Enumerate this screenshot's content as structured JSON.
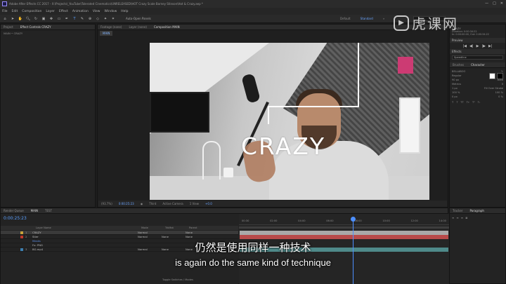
{
  "window": {
    "title": "Adobe After Effects CC 2017 - X:\\Projects\\_YouTube\\Tolerated Cinematics\\UNRELEASED\\HOT Crazy Scale Barney Stinson\\Hot & Crazy.aep *",
    "min": "—",
    "max": "□",
    "close": "✕"
  },
  "menu": [
    "File",
    "Edit",
    "Composition",
    "Layer",
    "Effect",
    "Animation",
    "View",
    "Window",
    "Help"
  ],
  "toolbar": {
    "auto_open": "Auto-Open Panels",
    "workspaces": [
      "Default",
      "Standard",
      "»"
    ],
    "active_workspace": "Standard"
  },
  "left_panel": {
    "tabs": [
      "Project",
      "Effect Controls CRAZY"
    ],
    "breadcrumb": "MAIN • CRAZY"
  },
  "comp_panel": {
    "tabs": [
      "Footage (none)",
      "Layer (none)",
      "Composition MAIN"
    ],
    "sub_tab": "MAIN",
    "overlay_text": "CRAZY",
    "bar": {
      "zoom": "(93.7%)",
      "timecode": "0:00:25:23",
      "resolution": "Third",
      "camera": "Active Camera",
      "view": "1 View",
      "exposure": "+0.0"
    }
  },
  "right_panel": {
    "info_title": "CRAZY",
    "info_lines": [
      "Duration: 0:00:34:22",
      "In: 0:00:00:00, Out: 0:00:34:22"
    ],
    "preview": "Preview",
    "preview_controls": [
      "|◀",
      "◀|",
      "▶",
      "|▶",
      "▶|"
    ],
    "effects": "Effects",
    "effects_field": "Speedline",
    "brushes": "Brushes",
    "character": "Character",
    "font": "BELLABOO",
    "font_style": "Regular",
    "size": "90 px",
    "leading": "Auto",
    "metrics": "Metrics",
    "tracking": "0",
    "stroke": "1 px",
    "stroke_mode": "Fill Over Stroke",
    "scale_v": "100 %",
    "scale_h": "100 %",
    "baseline": "0 px",
    "tsume": "0 %"
  },
  "timeline": {
    "tabs": [
      "Render Queue",
      "MAIN",
      "TEST"
    ],
    "time": "0:00:25:23",
    "columns": [
      "Layer Name",
      "Mode",
      "TrkMat",
      "Parent"
    ],
    "layers": [
      {
        "num": "1",
        "name": "CRAZY",
        "mode": "Normal",
        "trkmat": "",
        "parent": "None",
        "color": "#c9a23a"
      },
      {
        "num": "2",
        "name": "Stier",
        "mode": "Normal",
        "trkmat": "None",
        "parent": "None",
        "color": "#c0392b"
      },
      {
        "num": "",
        "name": "Masks",
        "mode": "",
        "trkmat": "",
        "parent": "",
        "color": "#2c62c4"
      },
      {
        "num": "",
        "name": "Fx: PNG",
        "mode": "",
        "trkmat": "",
        "parent": "",
        "color": "#777"
      },
      {
        "num": "3",
        "name": "BG.mp4",
        "mode": "Normal",
        "trkmat": "None",
        "parent": "None",
        "color": "#3c7fb0"
      }
    ],
    "ruler": [
      "00:30",
      "02:00",
      "04:00",
      "06:00",
      "08:00",
      "10:00",
      "12:00",
      "14:00"
    ],
    "footer": "Toggle Switches / Modes"
  },
  "right_bottom": {
    "tabs": [
      "Tracker",
      "Paragraph"
    ]
  },
  "subtitles": {
    "zh": "仍然是使用同样一种技术",
    "en": "is again do the same kind of technique"
  },
  "watermark": "虎课网",
  "colors": {
    "accent": "#4d8fff",
    "crazy_bar": "#a9a9a9",
    "stier_bar": "#b84a4a",
    "bg_bar": "#4f8a8a"
  }
}
